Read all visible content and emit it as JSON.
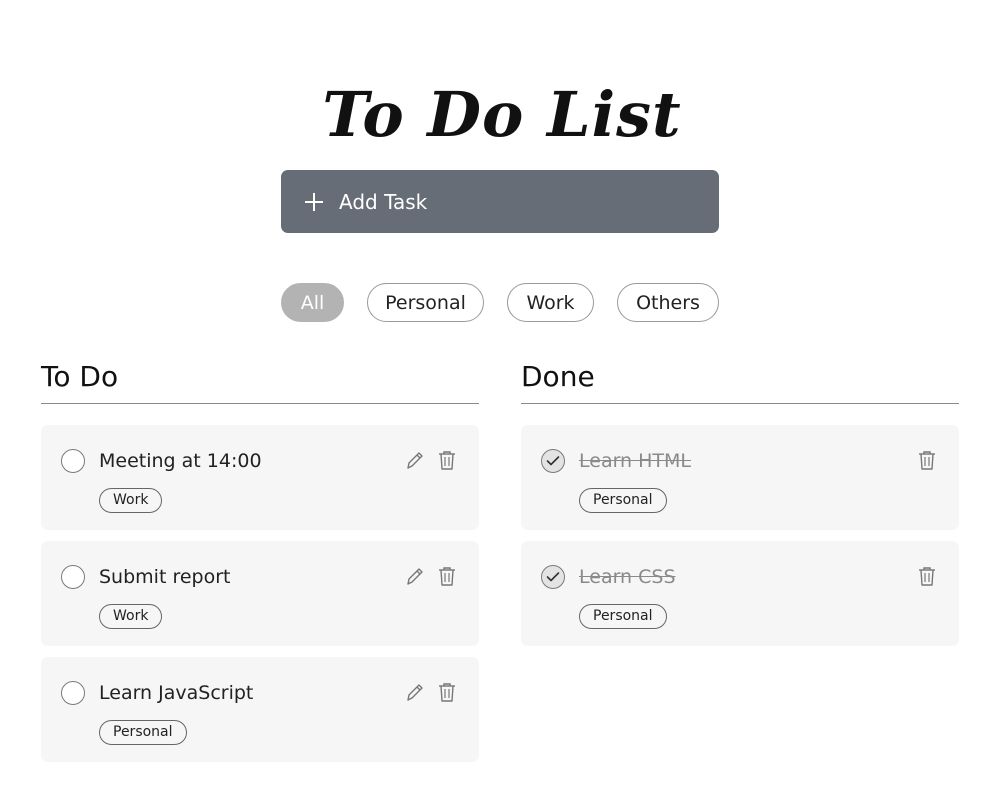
{
  "app": {
    "title": "To Do List"
  },
  "add_task": {
    "label": "Add Task",
    "icon": "plus-icon"
  },
  "filters": [
    {
      "label": "All",
      "active": true
    },
    {
      "label": "Personal",
      "active": false
    },
    {
      "label": "Work",
      "active": false
    },
    {
      "label": "Others",
      "active": false
    }
  ],
  "columns": {
    "todo": {
      "title": "To Do",
      "tasks": [
        {
          "text": "Meeting at 14:00",
          "tag": "Work",
          "done": false
        },
        {
          "text": "Submit report",
          "tag": "Work",
          "done": false
        },
        {
          "text": "Learn JavaScript",
          "tag": "Personal",
          "done": false
        }
      ]
    },
    "done": {
      "title": "Done",
      "tasks": [
        {
          "text": "Learn HTML",
          "tag": "Personal",
          "done": true
        },
        {
          "text": "Learn CSS",
          "tag": "Personal",
          "done": true
        }
      ]
    }
  },
  "colors": {
    "add_task_bg": "#666d77",
    "active_filter_bg": "#b3b3b3",
    "card_bg": "#f6f6f6",
    "done_text": "#8a8a8a"
  }
}
